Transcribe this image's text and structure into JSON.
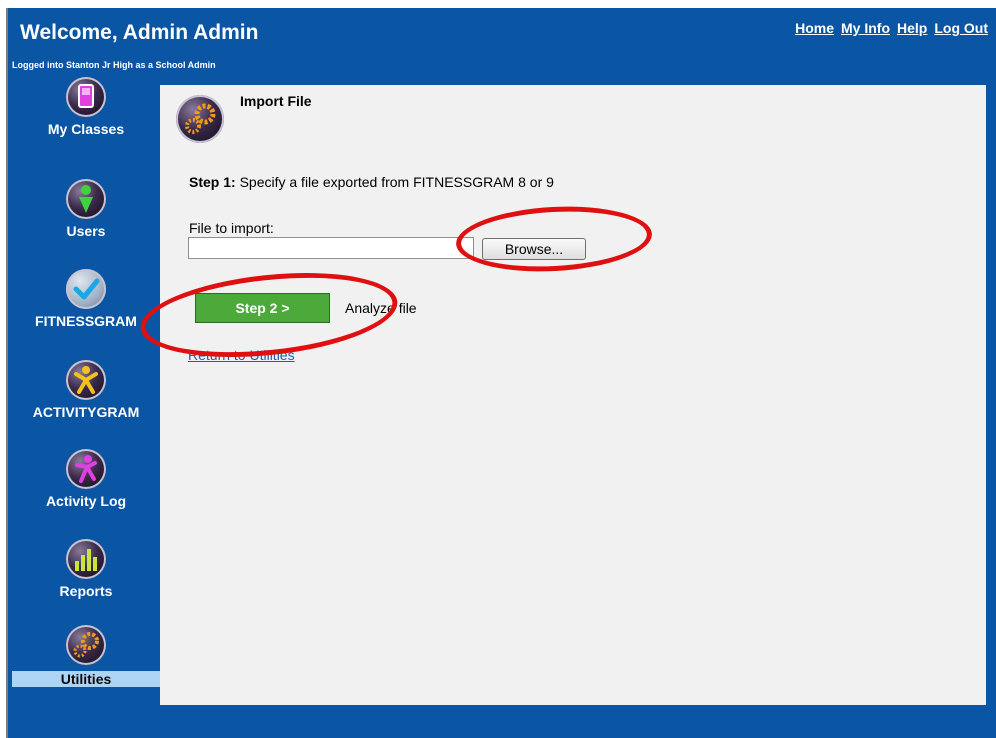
{
  "header": {
    "welcome": "Welcome, Admin Admin",
    "logged_in": "Logged into Stanton Jr High as a School Admin",
    "links": [
      "Home",
      "My Info",
      "Help",
      "Log Out"
    ]
  },
  "sidebar": {
    "items": [
      {
        "label": "My Classes",
        "icon": "classroom-door-icon"
      },
      {
        "label": "Users",
        "icon": "user-person-icon"
      },
      {
        "label": "FITNESSGRAM",
        "icon": "checkmark-icon"
      },
      {
        "label": "ACTIVITYGRAM",
        "icon": "activity-figure-icon"
      },
      {
        "label": "Activity Log",
        "icon": "running-figure-icon"
      },
      {
        "label": "Reports",
        "icon": "bar-chart-icon"
      },
      {
        "label": "Utilities",
        "icon": "gears-icon"
      }
    ],
    "active": "Utilities"
  },
  "main": {
    "title": "Import File",
    "title_icon": "gears-icon",
    "step1_label": "Step 1:",
    "step1_text": "Specify a file exported from FITNESSGRAM 8 or 9",
    "file_label": "File to import:",
    "file_value": "",
    "browse_label": "Browse...",
    "step2_label": "Step 2 >",
    "analyze_text": "Analyze file",
    "return_link": "Return to Utilities"
  },
  "colors": {
    "header_blue": "#0b56a4",
    "content_bg": "#f1f1f1",
    "active_nav": "#aed4f4",
    "step2_green": "#4caa3a",
    "annotation_red": "#e01010"
  }
}
